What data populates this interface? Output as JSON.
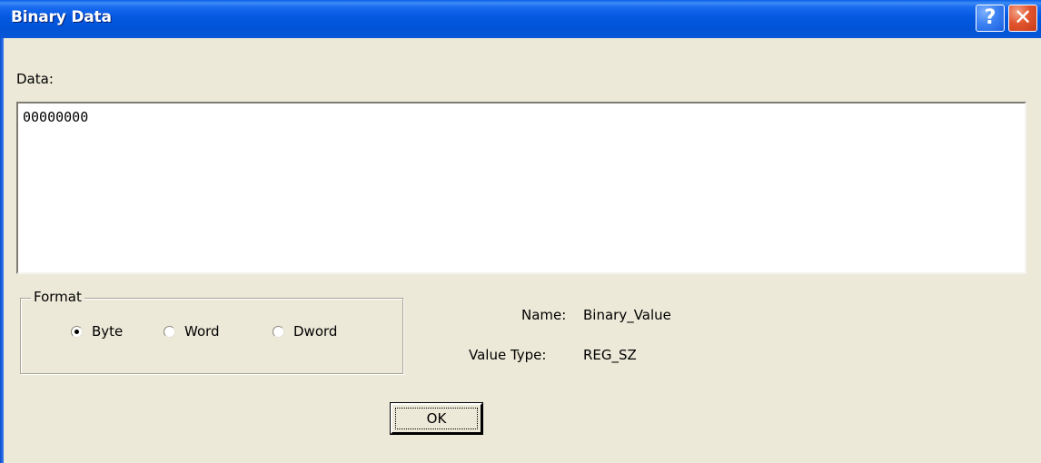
{
  "window": {
    "title": "Binary Data",
    "help_glyph": "?",
    "close_glyph": "✕",
    "titlebar_color": "#0054e3",
    "dialog_bg": "#ece9d8"
  },
  "data_section": {
    "label": "Data:",
    "value": "00000000"
  },
  "format": {
    "legend": "Format",
    "options": [
      {
        "label": "Byte",
        "checked": true
      },
      {
        "label": "Word",
        "checked": false
      },
      {
        "label": "Dword",
        "checked": false
      }
    ]
  },
  "info": {
    "name_label": "Name:",
    "name_value": "Binary_Value",
    "type_label": "Value Type:",
    "type_value": "REG_SZ"
  },
  "buttons": {
    "ok_label": "OK"
  },
  "icons": {
    "help": "help-icon",
    "close": "close-icon"
  }
}
